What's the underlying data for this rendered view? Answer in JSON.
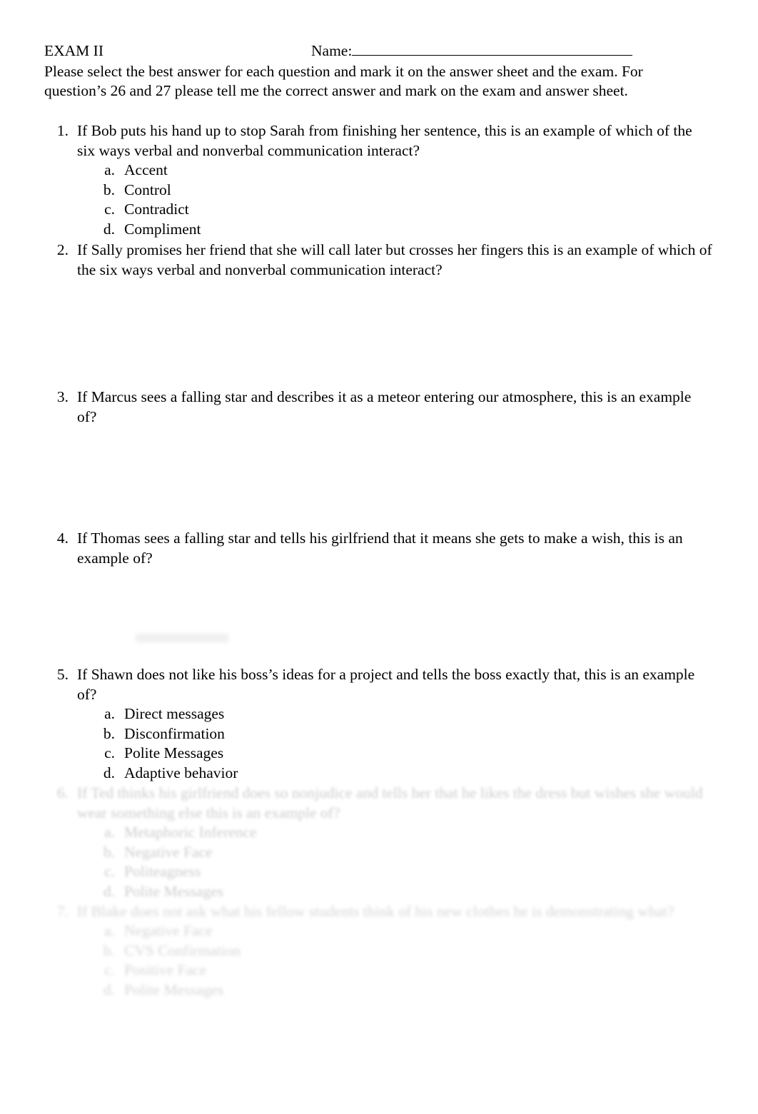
{
  "header": {
    "exam_title": "EXAM II",
    "name_label": "Name:",
    "instructions": "Please select the best answer for each question and mark it on the answer sheet and the exam. For question’s 26 and 27 please tell me the correct answer and mark on the exam and answer sheet."
  },
  "questions": [
    {
      "number": "1.",
      "text": "If Bob puts his hand up to stop Sarah from finishing her sentence, this is an example of which of the six ways verbal and nonverbal communication interact?",
      "options": [
        {
          "letter": "a.",
          "text": "Accent"
        },
        {
          "letter": "b.",
          "text": "Control"
        },
        {
          "letter": "c.",
          "text": "Contradict"
        },
        {
          "letter": "d.",
          "text": "Compliment"
        }
      ]
    },
    {
      "number": "2.",
      "text": "If Sally promises her friend that she will call later but crosses her fingers this is an example of which of the six ways verbal and nonverbal communication interact?",
      "options": []
    },
    {
      "number": "3.",
      "text": "If Marcus sees a falling star and describes it as a meteor entering our atmosphere, this is an example of?",
      "options": []
    },
    {
      "number": "4.",
      "text": "If Thomas sees a falling star and tells his girlfriend that it means she gets to make a wish, this is an example of?",
      "options": []
    },
    {
      "number": "5.",
      "text": "If Shawn does not like his boss’s ideas for a project and tells the boss exactly that, this is an example of?",
      "options": [
        {
          "letter": "a.",
          "text": "Direct messages"
        },
        {
          "letter": "b.",
          "text": "Disconfirmation"
        },
        {
          "letter": "c.",
          "text": "Polite Messages"
        },
        {
          "letter": "d.",
          "text": "Adaptive behavior"
        }
      ]
    },
    {
      "number": "6.",
      "text": "If Ted thinks his girlfriend does so nonjudice and tells her that he likes the dress but wishes she would wear something else this is an example of?",
      "options": [
        {
          "letter": "a.",
          "text": "Metaphoric Inference"
        },
        {
          "letter": "b.",
          "text": "Negative Face"
        },
        {
          "letter": "c.",
          "text": "Politeagness"
        },
        {
          "letter": "d.",
          "text": "Polite Messages"
        }
      ]
    },
    {
      "number": "7.",
      "text": "If Blake does not ask what his fellow students think of his new clothes he is demonstrating what?",
      "options": [
        {
          "letter": "a.",
          "text": "Negative Face"
        },
        {
          "letter": "b.",
          "text": "CVS Confirmation"
        },
        {
          "letter": "c.",
          "text": "Positive Face"
        },
        {
          "letter": "d.",
          "text": "Polite Messages"
        }
      ]
    }
  ]
}
